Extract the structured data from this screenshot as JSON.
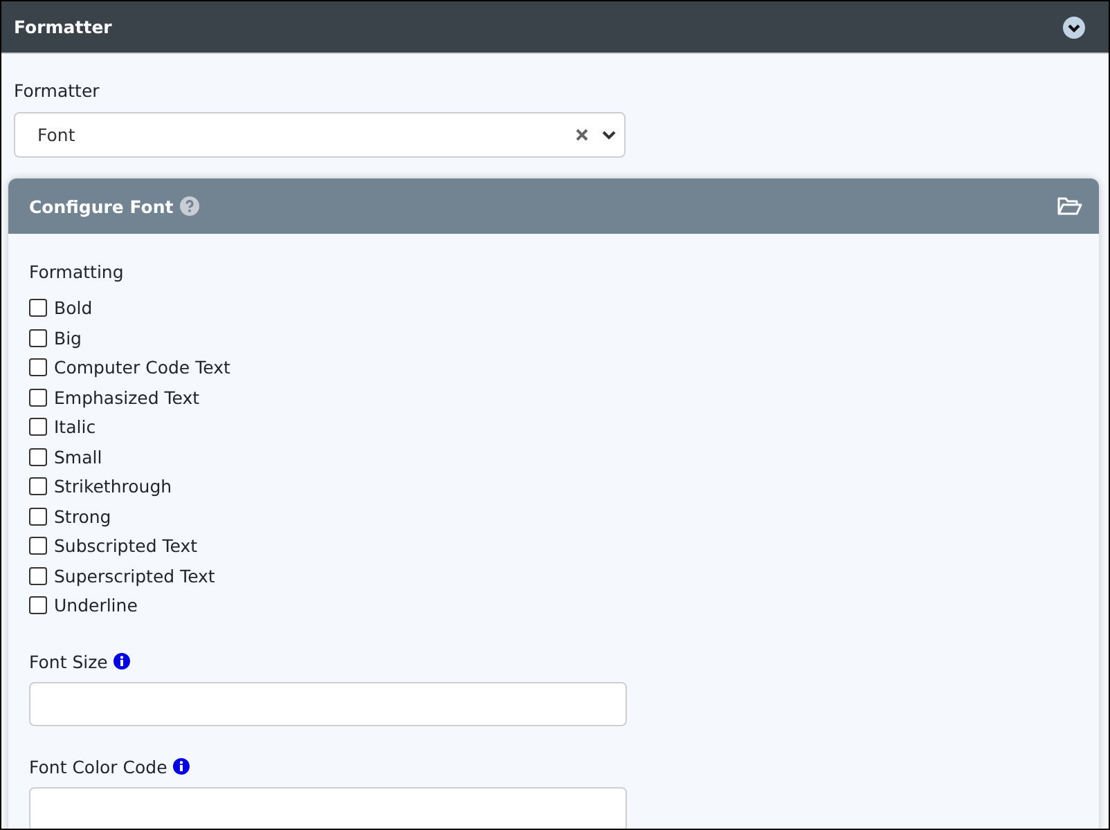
{
  "panel": {
    "title": "Formatter"
  },
  "formatter_field": {
    "label": "Formatter",
    "value": "Font"
  },
  "card": {
    "title": "Configure Font",
    "formatting": {
      "label": "Formatting",
      "options": [
        {
          "label": "Bold",
          "checked": false
        },
        {
          "label": "Big",
          "checked": false
        },
        {
          "label": "Computer Code Text",
          "checked": false
        },
        {
          "label": "Emphasized Text",
          "checked": false
        },
        {
          "label": "Italic",
          "checked": false
        },
        {
          "label": "Small",
          "checked": false
        },
        {
          "label": "Strikethrough",
          "checked": false
        },
        {
          "label": "Strong",
          "checked": false
        },
        {
          "label": "Subscripted Text",
          "checked": false
        },
        {
          "label": "Superscripted Text",
          "checked": false
        },
        {
          "label": "Underline",
          "checked": false
        }
      ]
    },
    "fields": [
      {
        "label": "Font Size"
      },
      {
        "label": "Font Color Code"
      }
    ]
  }
}
